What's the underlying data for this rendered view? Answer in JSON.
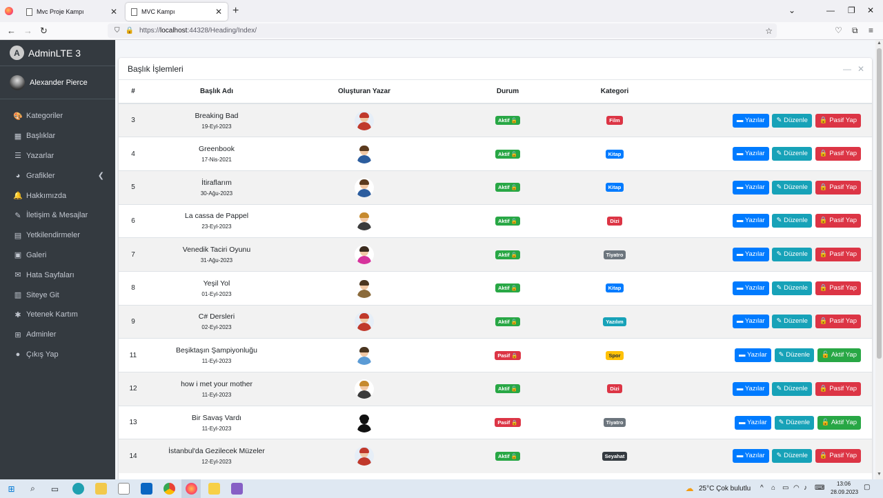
{
  "browser": {
    "tabs": [
      {
        "label": "Mvc Proje Kampı",
        "active": false
      },
      {
        "label": "MVC Kampı",
        "active": true
      }
    ],
    "url_prefix": "https://",
    "url_host": "localhost",
    "url_path": ":44328/Heading/Index/"
  },
  "sidebar": {
    "brand": "AdminLTE 3",
    "user": "Alexander Pierce",
    "items": [
      {
        "label": "Kategoriler",
        "icon": "palette-icon"
      },
      {
        "label": "Başlıklar",
        "icon": "grid-icon"
      },
      {
        "label": "Yazarlar",
        "icon": "list-icon"
      },
      {
        "label": "Grafikler",
        "icon": "pie-chart-icon"
      },
      {
        "label": "Hakkımızda",
        "icon": "bell-icon"
      },
      {
        "label": "İletişim & Mesajlar",
        "icon": "edit-icon"
      },
      {
        "label": "Yetkilendirmeler",
        "icon": "calendar-icon"
      },
      {
        "label": "Galeri",
        "icon": "image-icon"
      },
      {
        "label": "Hata Sayfaları",
        "icon": "envelope-icon"
      },
      {
        "label": "Siteye Git",
        "icon": "file-icon"
      },
      {
        "label": "Yetenek Kartım",
        "icon": "asterisk-icon"
      },
      {
        "label": "Adminler",
        "icon": "user-icon"
      },
      {
        "label": "Çıkış Yap",
        "icon": "apple-icon"
      }
    ]
  },
  "card": {
    "title": "Başlık İşlemleri"
  },
  "table": {
    "headers": [
      "#",
      "Başlık Adı",
      "Oluşturan Yazar",
      "Durum",
      "Kategori",
      ""
    ],
    "rows": [
      {
        "id": "3",
        "title": "Breaking Bad",
        "date": "19-Eyl-2023",
        "avatar": "woman-red",
        "status": "Aktif",
        "category": "Film",
        "cat_color": "#dc3545",
        "toggle": "Pasif Yap"
      },
      {
        "id": "4",
        "title": "Greenbook",
        "date": "17-Nis-2021",
        "avatar": "man-blue",
        "status": "Aktif",
        "category": "Kitap",
        "cat_color": "#007bff",
        "toggle": "Pasif Yap"
      },
      {
        "id": "5",
        "title": "İtiraflarım",
        "date": "30-Ağu-2023",
        "avatar": "man-blue",
        "status": "Aktif",
        "category": "Kitap",
        "cat_color": "#007bff",
        "toggle": "Pasif Yap"
      },
      {
        "id": "6",
        "title": "La cassa de Pappel",
        "date": "23-Eyl-2023",
        "avatar": "woman-blonde",
        "status": "Aktif",
        "category": "Dizi",
        "cat_color": "#dc3545",
        "toggle": "Pasif Yap"
      },
      {
        "id": "7",
        "title": "Venedik Taciri Oyunu",
        "date": "31-Ağu-2023",
        "avatar": "woman-pink",
        "status": "Aktif",
        "category": "Tiyatro",
        "cat_color": "#6c757d",
        "toggle": "Pasif Yap"
      },
      {
        "id": "8",
        "title": "Yeşil Yol",
        "date": "01-Eyl-2023",
        "avatar": "man-brown",
        "status": "Aktif",
        "category": "Kitap",
        "cat_color": "#007bff",
        "toggle": "Pasif Yap"
      },
      {
        "id": "9",
        "title": "C# Dersleri",
        "date": "02-Eyl-2023",
        "avatar": "woman-red",
        "status": "Aktif",
        "category": "Yazılım",
        "cat_color": "#17a2b8",
        "toggle": "Pasif Yap"
      },
      {
        "id": "11",
        "title": "Beşiktaşın Şampiyonluğu",
        "date": "11-Eyl-2023",
        "avatar": "man-light",
        "status": "Pasif",
        "category": "Spor",
        "cat_color": "#ffc107",
        "toggle": "Aktif Yap"
      },
      {
        "id": "12",
        "title": "how i met your mother",
        "date": "11-Eyl-2023",
        "avatar": "woman-blonde",
        "status": "Aktif",
        "category": "Dizi",
        "cat_color": "#dc3545",
        "toggle": "Pasif Yap"
      },
      {
        "id": "13",
        "title": "Bir Savaş Vardı",
        "date": "11-Eyl-2023",
        "avatar": "silhouette",
        "status": "Pasif",
        "category": "Tiyatro",
        "cat_color": "#6c757d",
        "toggle": "Aktif Yap"
      },
      {
        "id": "14",
        "title": "İstanbul'da Gezilecek Müzeler",
        "date": "12-Eyl-2023",
        "avatar": "woman-red",
        "status": "Aktif",
        "category": "Seyahat",
        "cat_color": "#343a40",
        "toggle": "Pasif Yap"
      }
    ],
    "btn_posts": "Yazılar",
    "btn_edit": "Düzenle"
  },
  "taskbar": {
    "weather": "25°C  Çok bulutlu",
    "time": "13:06",
    "date": "28.09.2023"
  },
  "colors": {
    "sidebar_bg": "#343a40",
    "active_green": "#28a745",
    "passive_red": "#dc3545",
    "primary": "#007bff",
    "info": "#17a2b8"
  }
}
